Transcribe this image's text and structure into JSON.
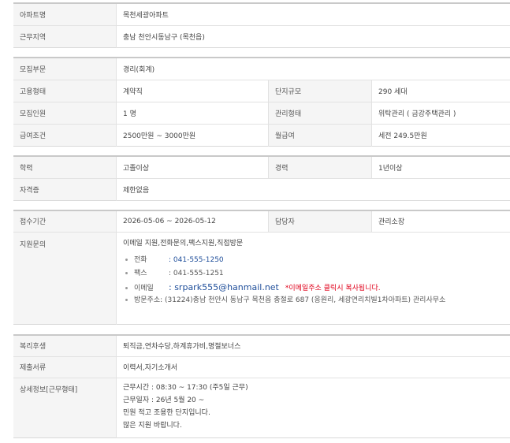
{
  "section1": {
    "apt_name_label": "아파트명",
    "apt_name_value": "목천세광아파트",
    "region_label": "근무지역",
    "region_value": "충남 천안시동남구 (목천읍)"
  },
  "section2": {
    "field_label": "모집부문",
    "field_value": "경리(회계)",
    "emp_type_label": "고용형태",
    "emp_type_value": "계약직",
    "scale_label": "단지규모",
    "scale_value": "290 세대",
    "headcount_label": "모집인원",
    "headcount_value": "1 명",
    "mgmt_label": "관리형태",
    "mgmt_value": "위탁관리 ( 금강주택관리 )",
    "salary_label": "급여조건",
    "salary_value": "2500만원 ~ 3000만원",
    "monthly_label": "월급여",
    "monthly_value": "세전 249.5만원"
  },
  "section3": {
    "edu_label": "학력",
    "edu_value": "고졸이상",
    "career_label": "경력",
    "career_value": "1년이상",
    "cert_label": "자격증",
    "cert_value": "제한없음"
  },
  "section4": {
    "period_label": "접수기간",
    "period_value": "2026-05-06 ~ 2026-05-12",
    "manager_label": "담당자",
    "manager_value": "관리소장",
    "inquiry_label": "지원문의",
    "inquiry_methods": "이메일 지원,전화문의,팩스지원,직접방문",
    "phone_label": "전화",
    "phone_value": ": 041-555-1250",
    "fax_label": "팩스",
    "fax_value": ": 041-555-1251",
    "email_label": "이메일",
    "email_value": ": srpark555@hanmail.net",
    "email_note": "*이메일주소 클릭시 복사됩니다.",
    "address_label": "방문주소",
    "address_value": ": (31224)충남 천안시 동남구 목천읍 충절로 687 (응원리, 세광연리치빌1차아파트) 관리사무소"
  },
  "section5": {
    "welfare_label": "복리후생",
    "welfare_value": "퇴직금,연차수당,하계휴가비,명절보너스",
    "docs_label": "제출서류",
    "docs_value": "이력서,자기소개서",
    "detail_label": "상세정보[근무형태]",
    "detail_lines": [
      "근무시간 : 08:30 ~ 17:30 (주5일 근무)",
      "근무일자 : 26년 5월 20 ~",
      "민원 적고 조용한 단지입니다.",
      "많은 지원 바랍니다."
    ]
  }
}
